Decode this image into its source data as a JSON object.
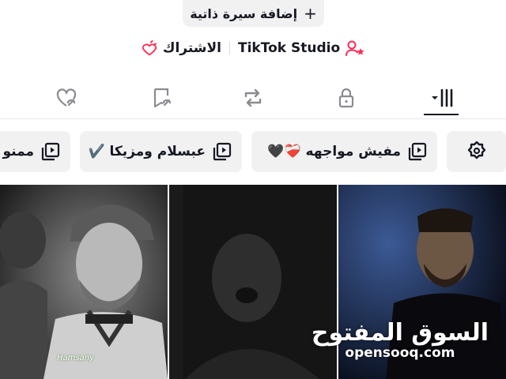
{
  "profile": {
    "add_bio_label": "إضافة سيرة ذاتية",
    "add_bio_icon": "plus-icon",
    "tiktok_studio_label": "TikTok Studio",
    "subscribe_label": "الاشتراك"
  },
  "tabs": [
    {
      "name": "videos",
      "icon": "grid-icon",
      "active": true
    },
    {
      "name": "private",
      "icon": "lock-icon",
      "active": false
    },
    {
      "name": "reposts",
      "icon": "repost-icon",
      "active": false
    },
    {
      "name": "favorites",
      "icon": "bookmark-icon",
      "active": false
    },
    {
      "name": "liked",
      "icon": "heart-icon",
      "active": false
    }
  ],
  "playlists": {
    "settings_icon": "gear-icon",
    "items": [
      {
        "label": "مفيش مواجهه ❤️‍🩹🖤"
      },
      {
        "label": "عبسلام ومزيكا ✔️"
      },
      {
        "label": "ممنو"
      }
    ]
  },
  "watermark": {
    "arabic": "السوق المفتوح",
    "latin": "opensooq.com"
  },
  "thumbnails": [
    {
      "caption": ""
    },
    {
      "caption": ""
    },
    {
      "caption": "Hamsany"
    }
  ],
  "colors": {
    "accent": "#fe2c55",
    "chip_bg": "#f1f1f2",
    "text": "#161823"
  }
}
